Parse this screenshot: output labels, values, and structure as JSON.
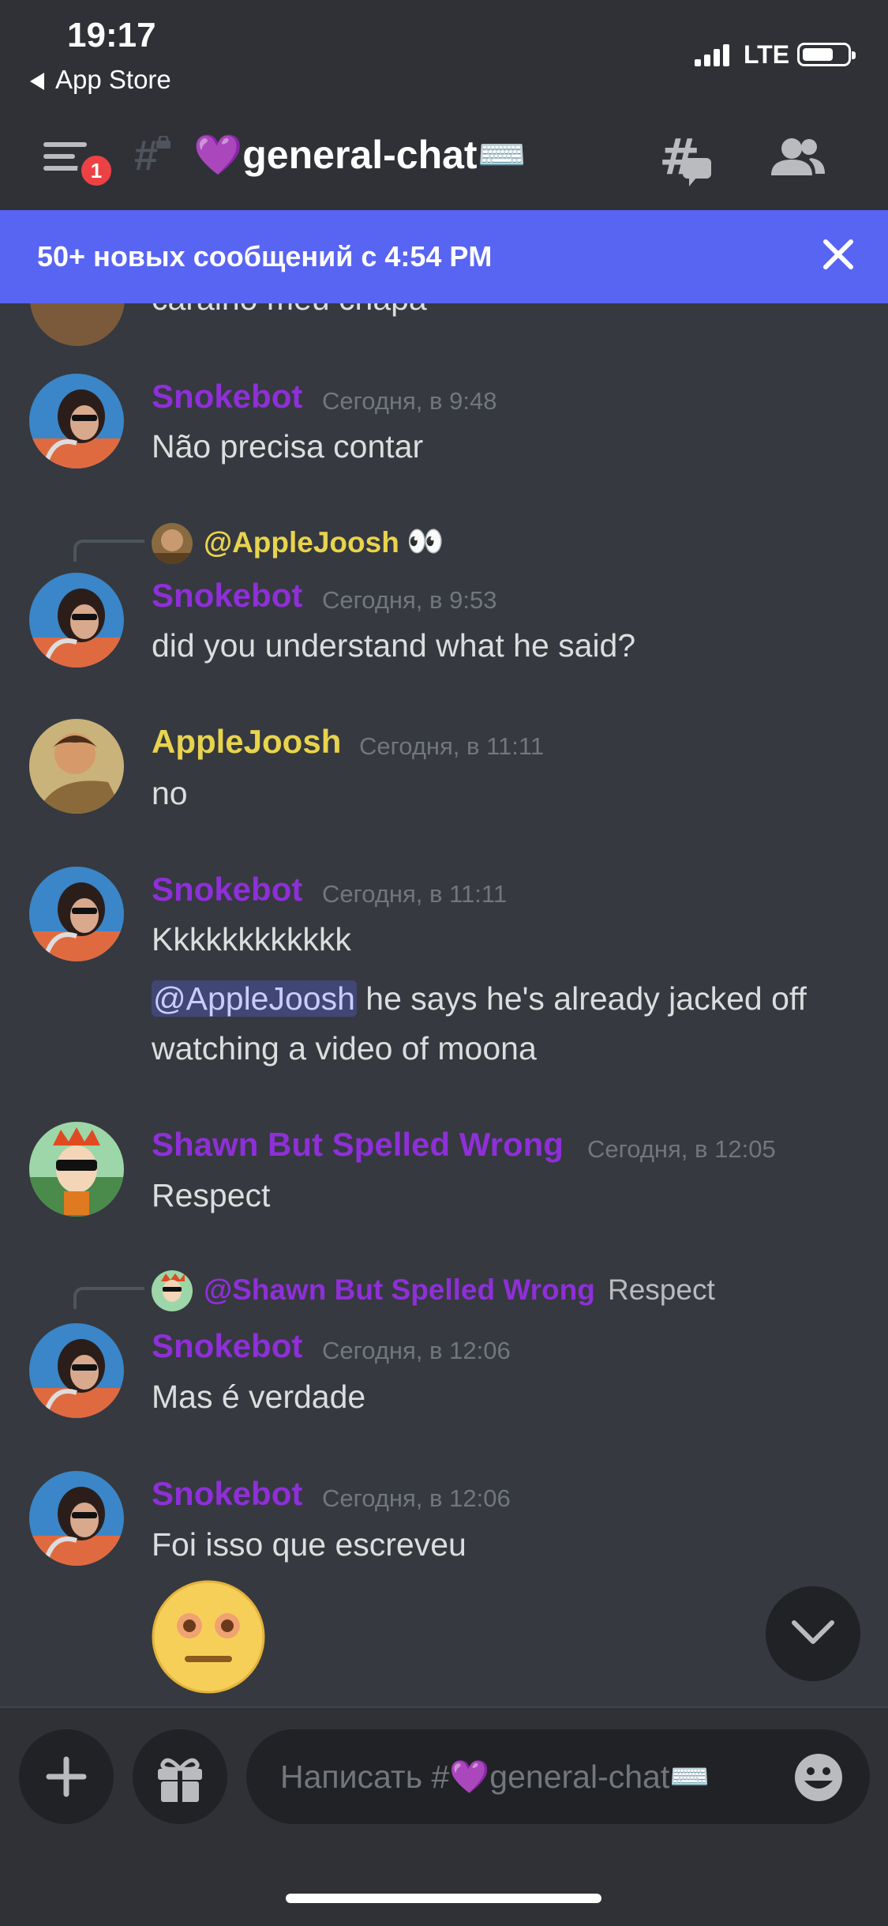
{
  "status_bar": {
    "time": "19:17",
    "back_label": "App Store",
    "network": "LTE"
  },
  "header": {
    "notification_count": "1",
    "channel_name": "💜general-chat⌨️",
    "icons": [
      "hamburger-menu-icon",
      "locked-channel-icon",
      "threads-icon",
      "members-icon"
    ]
  },
  "new_messages_bar": {
    "text": "50+ новых сообщений с 4:54 PM"
  },
  "chat": {
    "cropped_text": "caralho meu chapa",
    "messages": [
      {
        "user": "Snokebot",
        "time": "Сегодня, в 9:48",
        "lines": [
          "Não precisa contar"
        ]
      },
      {
        "reply_user": "@AppleJoosh",
        "reply_text": "👀",
        "user": "Snokebot",
        "time": "Сегодня, в 9:53",
        "lines": [
          "did you understand what he said?"
        ]
      },
      {
        "user": "AppleJoosh",
        "time": "Сегодня, в 11:11",
        "lines": [
          "no"
        ]
      },
      {
        "user": "Snokebot",
        "time": "Сегодня, в 11:11",
        "lines": [
          "Kkkkkkkkkkkk"
        ],
        "mention": "@AppleJoosh",
        "mention_text": " he says he's already jacked off",
        "line3": "watching a video of moona"
      },
      {
        "user": "Shawn But Spelled Wrong",
        "time": "Сегодня, в 12:05",
        "lines": [
          "Respect"
        ]
      },
      {
        "reply_user": "@Shawn But Spelled Wrong",
        "reply_text": "Respect",
        "user": "Snokebot",
        "time": "Сегодня, в 12:06",
        "lines": [
          "Mas é verdade"
        ]
      },
      {
        "user": "Snokebot",
        "time": "Сегодня, в 12:06",
        "lines": [
          "Foi isso que escreveu"
        ]
      }
    ],
    "colors": {
      "snokebot": "#8e2fd8",
      "applejoosh": "#e8d44d",
      "shawn": "#8e2fd8",
      "blurple": "#5865f2"
    }
  },
  "input": {
    "placeholder": "Написать #💜general-chat⌨️"
  }
}
